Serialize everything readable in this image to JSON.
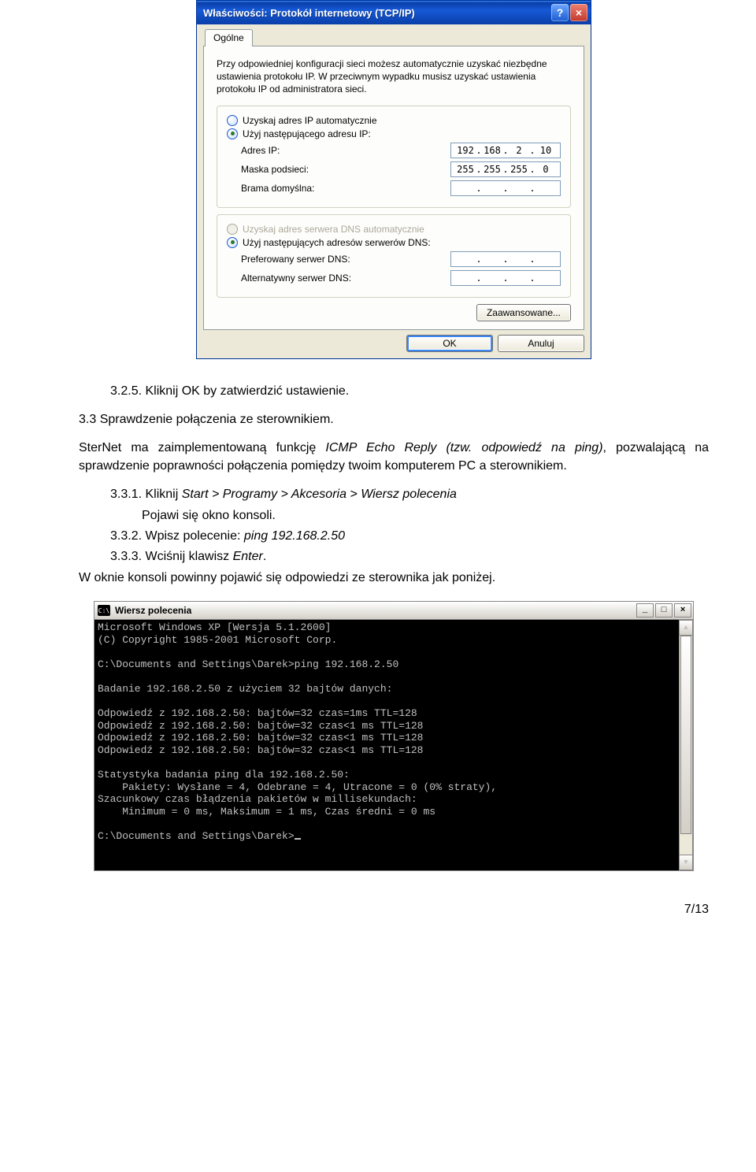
{
  "xp_dialog": {
    "title": "Właściwości: Protokół internetowy (TCP/IP)",
    "tab": "Ogólne",
    "intro": "Przy odpowiedniej konfiguracji sieci możesz automatycznie uzyskać niezbędne ustawienia protokołu IP. W przeciwnym wypadku musisz uzyskać ustawienia protokołu IP od administratora sieci.",
    "radio_ip_auto": "Uzyskaj adres IP automatycznie",
    "radio_ip_manual": "Użyj następującego adresu IP:",
    "lbl_ip": "Adres IP:",
    "lbl_mask": "Maska podsieci:",
    "lbl_gateway": "Brama domyślna:",
    "ip": {
      "o1": "192",
      "o2": "168",
      "o3": "2",
      "o4": "10"
    },
    "mask": {
      "o1": "255",
      "o2": "255",
      "o3": "255",
      "o4": "0"
    },
    "gateway": {
      "o1": "",
      "o2": "",
      "o3": "",
      "o4": ""
    },
    "radio_dns_auto": "Uzyskaj adres serwera DNS automatycznie",
    "radio_dns_manual": "Użyj następujących adresów serwerów DNS:",
    "lbl_dns_pref": "Preferowany serwer DNS:",
    "lbl_dns_alt": "Alternatywny serwer DNS:",
    "dns_pref": {
      "o1": "",
      "o2": "",
      "o3": "",
      "o4": ""
    },
    "dns_alt": {
      "o1": "",
      "o2": "",
      "o3": "",
      "o4": ""
    },
    "btn_advanced": "Zaawansowane...",
    "btn_ok": "OK",
    "btn_cancel": "Anuluj"
  },
  "doc": {
    "s325": "3.2.5. Kliknij OK by zatwierdzić ustawienie.",
    "h33": "3.3 Sprawdzenie połączenia ze sterownikiem.",
    "p33_a": "SterNet ma zaimplementowaną funkcję ",
    "p33_b": "ICMP Echo Reply (tzw. odpowiedź na ping)",
    "p33_c": ", pozwalającą na sprawdzenie poprawności połączenia pomiędzy twoim komputerem PC a sterownikiem.",
    "s331_a": "3.3.1. Kliknij ",
    "s331_b": "Start > Programy > Akcesoria > Wiersz polecenia",
    "s331_sub": "Pojawi się okno konsoli.",
    "s332_a": "3.3.2. Wpisz polecenie: ",
    "s332_b": "ping 192.168.2.50",
    "s333_a": "3.3.3. Wciśnij klawisz ",
    "s333_b": "Enter",
    "s333_c": ".",
    "p_after": "W oknie konsoli powinny pojawić się odpowiedzi ze sterownika jak poniżej."
  },
  "cmd": {
    "title": "Wiersz polecenia",
    "icon_text": "C:\\",
    "l1": "Microsoft Windows XP [Wersja 5.1.2600]",
    "l2": "(C) Copyright 1985-2001 Microsoft Corp.",
    "l3": "",
    "l4": "C:\\Documents and Settings\\Darek>ping 192.168.2.50",
    "l5": "",
    "l6": "Badanie 192.168.2.50 z użyciem 32 bajtów danych:",
    "l7": "",
    "l8": "Odpowiedź z 192.168.2.50: bajtów=32 czas=1ms TTL=128",
    "l9": "Odpowiedź z 192.168.2.50: bajtów=32 czas<1 ms TTL=128",
    "l10": "Odpowiedź z 192.168.2.50: bajtów=32 czas<1 ms TTL=128",
    "l11": "Odpowiedź z 192.168.2.50: bajtów=32 czas<1 ms TTL=128",
    "l12": "",
    "l13": "Statystyka badania ping dla 192.168.2.50:",
    "l14": "    Pakiety: Wysłane = 4, Odebrane = 4, Utracone = 0 (0% straty),",
    "l15": "Szacunkowy czas błądzenia pakietów w millisekundach:",
    "l16": "    Minimum = 0 ms, Maksimum = 1 ms, Czas średni = 0 ms",
    "l17": "",
    "l18": "C:\\Documents and Settings\\Darek>"
  },
  "page_number": "7/13"
}
